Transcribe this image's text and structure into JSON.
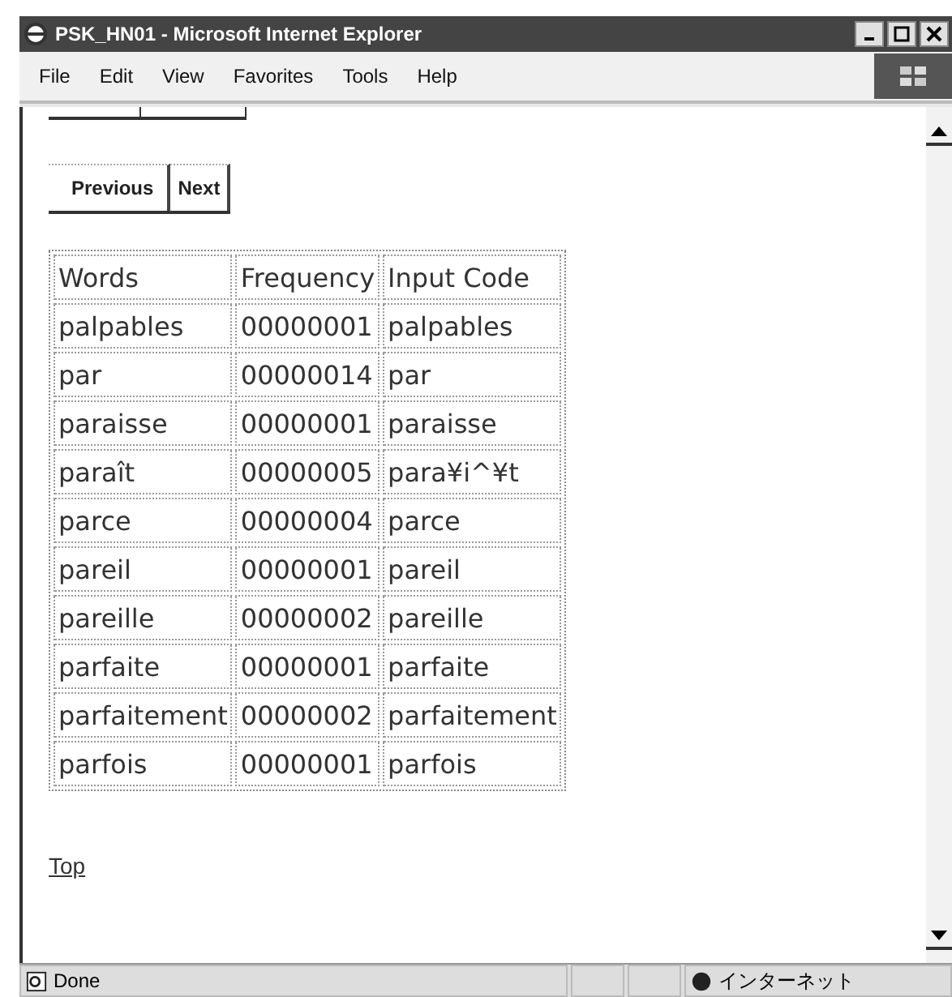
{
  "window": {
    "title": "PSK_HN01 - Microsoft Internet Explorer"
  },
  "menu": [
    "File",
    "Edit",
    "View",
    "Favorites",
    "Tools",
    "Help"
  ],
  "nav_buttons": [
    "Previous",
    "Next"
  ],
  "table": {
    "columns": [
      "Words",
      "Frequency",
      "Input Code"
    ],
    "rows": [
      [
        "palpables",
        "00000001",
        "palpables"
      ],
      [
        "par",
        "00000014",
        "par"
      ],
      [
        "paraisse",
        "00000001",
        "paraisse"
      ],
      [
        "paraît",
        "00000005",
        "para¥i^¥t"
      ],
      [
        "parce",
        "00000004",
        "parce"
      ],
      [
        "pareil",
        "00000001",
        "pareil"
      ],
      [
        "pareille",
        "00000002",
        "pareille"
      ],
      [
        "parfaite",
        "00000001",
        "parfaite"
      ],
      [
        "parfaitement",
        "00000002",
        "parfaitement"
      ],
      [
        "parfois",
        "00000001",
        "parfois"
      ]
    ]
  },
  "top_link": "Top",
  "status_bar": {
    "status": "Done",
    "zone": "インターネット"
  }
}
